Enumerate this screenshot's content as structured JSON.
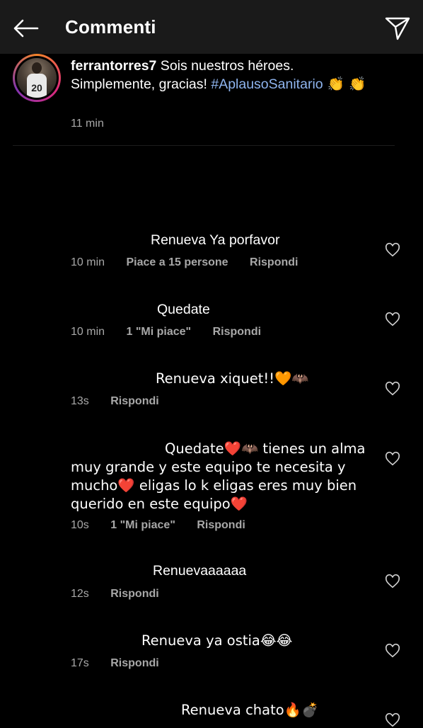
{
  "header": {
    "title": "Commenti",
    "back_icon": "arrow-left-icon",
    "send_icon": "paper-plane-icon"
  },
  "post": {
    "username": "ferrantorres7",
    "caption_part1": " Sois nuestros héroes. Simplemente, gracias! ",
    "hashtag": "#AplausoSanitario",
    "caption_emoji": " 👏 👏",
    "time": "11 min",
    "avatar_number": "20"
  },
  "comments": [
    {
      "text": "Renueva Ya porfavor",
      "time": "10 min",
      "likes": "Piace a 15 persone",
      "reply": "Rispondi"
    },
    {
      "text": "Quedate",
      "time": "10 min",
      "likes": "1 \"Mi piace\"",
      "reply": "Rispondi"
    },
    {
      "text": "Renueva xiquet!!🧡🦇",
      "time": "13s",
      "likes": "",
      "reply": "Rispondi"
    },
    {
      "text": "Quedate❤️🦇 tienes un alma muy grande y este equipo te necesita y mucho❤️ eligas lo k eligas eres muy bien querido en este equipo❤️",
      "time": "10s",
      "likes": "1 \"Mi piace\"",
      "reply": "Rispondi"
    },
    {
      "text": "Renuevaaaaaa",
      "time": "12s",
      "likes": "",
      "reply": "Rispondi"
    },
    {
      "text": "Renueva ya ostia😂😂",
      "time": "17s",
      "likes": "",
      "reply": "Rispondi"
    },
    {
      "text": "Renueva chato🔥💣",
      "time": "",
      "likes": "",
      "reply": ""
    }
  ],
  "colors": {
    "header_bg": "#1a1a1a",
    "background": "#000000",
    "secondary_text": "#a8a8a8",
    "hashtag": "#8fb5ef"
  }
}
